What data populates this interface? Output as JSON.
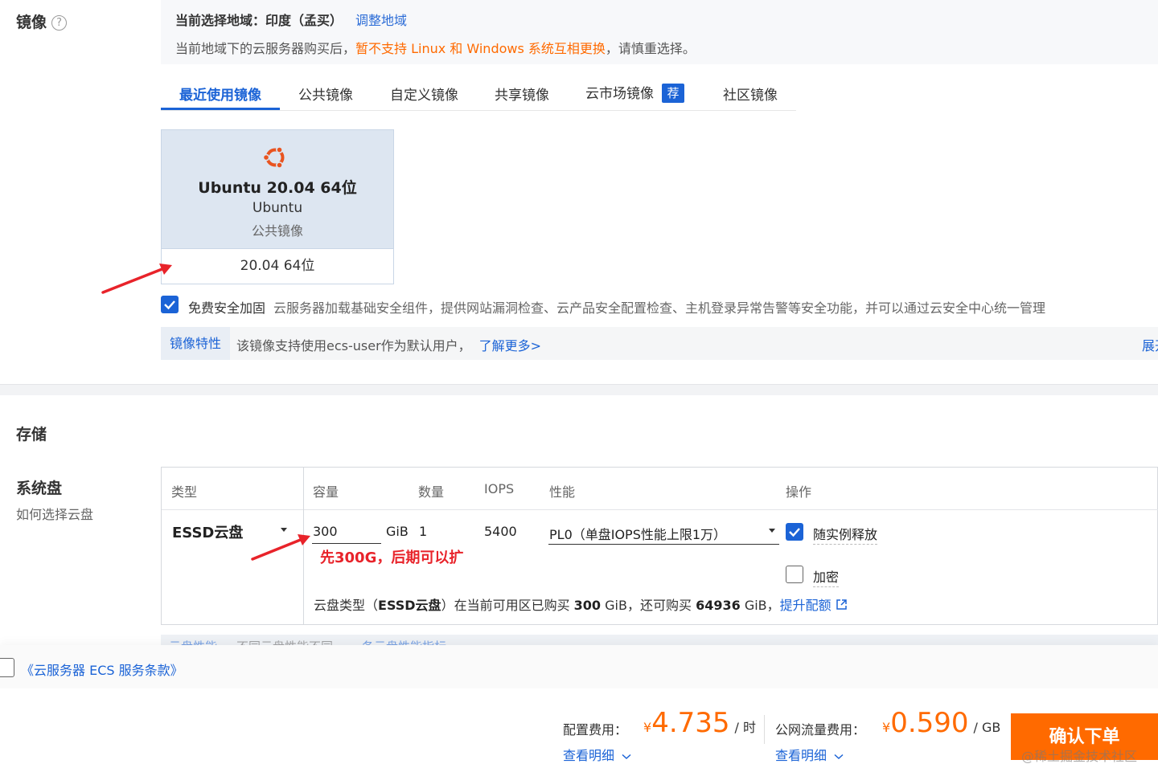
{
  "image_section": {
    "label": "镜像",
    "help": "?",
    "region_prefix": "当前选择地域：印度（孟买）",
    "region_adjust": "调整地域",
    "notice_prefix": "当前地域下的云服务器购买后，",
    "notice_warn": "暂不支持 Linux 和 Windows 系统互相更换",
    "notice_suffix": "，请慎重选择。",
    "tabs": [
      "最近使用镜像",
      "公共镜像",
      "自定义镜像",
      "共享镜像",
      "云市场镜像",
      "社区镜像"
    ],
    "recommend_badge": "荐",
    "card": {
      "name": "Ubuntu 20.04 64位",
      "os": "Ubuntu",
      "category": "公共镜像",
      "version": "20.04 64位"
    },
    "security": {
      "label": "免费安全加固",
      "description": "云服务器加载基础安全组件，提供网站漏洞检查、云产品安全配置检查、主机登录异常告警等安全功能，并可以通过云安全中心统一管理"
    },
    "feature": {
      "label": "镜像特性",
      "text": "该镜像支持使用ecs-user作为默认用户，",
      "learn_more": "了解更多>",
      "expand": "展开"
    }
  },
  "storage": {
    "title": "存储",
    "system_disk_title": "系统盘",
    "system_disk_help": "如何选择云盘",
    "headers": {
      "type": "类型",
      "capacity": "容量",
      "quantity": "数量",
      "iops": "IOPS",
      "performance": "性能",
      "actions": "操作"
    },
    "row": {
      "type": "ESSD云盘",
      "capacity": "300",
      "unit": "GiB",
      "quantity": "1",
      "iops": "5400",
      "performance": "PL0（单盘IOPS性能上限1万）",
      "release_with_instance": "随实例释放",
      "encrypt": "加密"
    },
    "annotation": "先300G，后期可以扩",
    "note_prefix": "云盘类型（",
    "note_type": "ESSD云盘",
    "note_mid1": "）在当前可用区已购买 ",
    "note_bought": "300",
    "note_mid2": " GiB，还可购买 ",
    "note_remaining": "64936",
    "note_mid3": " GiB，",
    "note_link": "提升配额",
    "cut_row": [
      "云盘性能",
      "不同云盘性能不同，",
      "各云盘性能指标"
    ]
  },
  "footer": {
    "agreement": "《云服务器 ECS 服务条款》",
    "config_fee_label": "配置费用：",
    "config_currency": "¥",
    "config_price": "4.735",
    "config_unit": "/ 时",
    "config_detail": "查看明细",
    "traffic_fee_label": "公网流量费用：",
    "traffic_currency": "¥",
    "traffic_price": "0.590",
    "traffic_unit": "/ GB",
    "traffic_detail": "查看明细",
    "buy_button": "确认下单",
    "watermark": "@稀土掘金技术社区"
  },
  "colors": {
    "primary": "#1b63d6",
    "warning": "#ff6a00",
    "annotation": "#e8232a"
  }
}
